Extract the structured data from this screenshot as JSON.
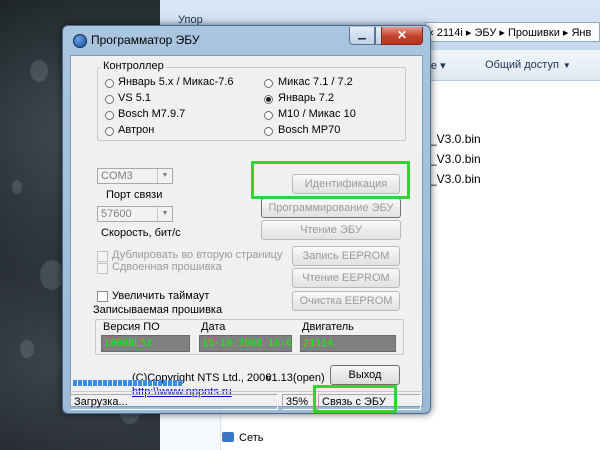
{
  "window": {
    "title": "Программатор ЭБУ",
    "minimize_glyph": "▁",
    "maximize_glyph": "▢",
    "close_glyph": "✕"
  },
  "controller_group": {
    "label": "Контроллер",
    "options": [
      {
        "label": "Январь 5.x / Микас-7.6",
        "checked": false
      },
      {
        "label": "VS 5.1",
        "checked": false
      },
      {
        "label": "Bosch M7.9.7",
        "checked": false
      },
      {
        "label": "Автрон",
        "checked": false
      },
      {
        "label": "Микас 7.1 / 7.2",
        "checked": false
      },
      {
        "label": "Январь 7.2",
        "checked": true
      },
      {
        "label": "M10 / Микас 10",
        "checked": false
      },
      {
        "label": "Bosch MP70",
        "checked": false
      }
    ]
  },
  "port": {
    "value": "COM3",
    "label": "Порт связи"
  },
  "speed": {
    "value": "57600",
    "label": "Скорость, бит/с"
  },
  "buttons": {
    "identify": "Идентификация",
    "program": "Программирование ЭБУ",
    "read_ecu": "Чтение ЭБУ",
    "write_eeprom": "Запись EEPROM",
    "read_eeprom": "Чтение EEPROM",
    "clear_eeprom": "Очистка EEPROM",
    "exit": "Выход"
  },
  "checkboxes": {
    "duplicate": "Дублировать во вторую страницу",
    "double_firmware": "Сдвоенная прошивка",
    "increase_timeout": "Увеличить таймаут"
  },
  "firmware_group": {
    "label": "Записываемая прошивка",
    "headers": {
      "version": "Версия ПО",
      "date": "Дата",
      "engine": "Двигатель"
    },
    "values": {
      "version": "1000BL52",
      "date": "15-10-2008 16:00",
      "engine": "21114"
    }
  },
  "copyright": {
    "text": "(C)Copyright NTS Ltd., 2006",
    "version": "v1.13(open)",
    "link": "http:\\\\www.nppnts.ru"
  },
  "status": {
    "text": "Загрузка...",
    "percent": "35%",
    "connection": "Связь с ЭБУ",
    "progress": 0.35
  },
  "explorer": {
    "window_fragment": "Упор",
    "breadcrumb": "‹ 2114i ▸ ЭБУ ▸ Прошивки ▸ Янв",
    "toolbar_left": "ке ▾",
    "toolbar_share": "Общий доступ",
    "files": [
      "_V3.0.bin",
      "_V3.0.bin",
      "_V3.0.bin"
    ],
    "network": "Сеть"
  }
}
